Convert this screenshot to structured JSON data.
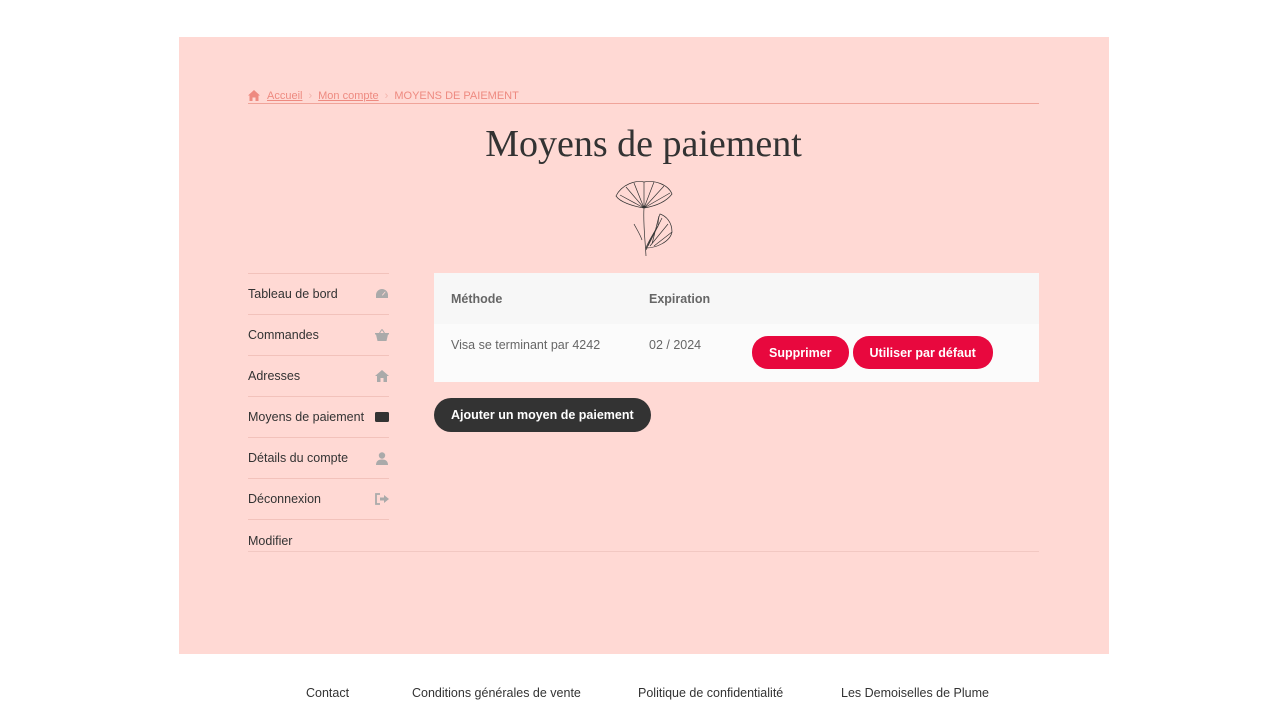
{
  "breadcrumb": {
    "home": "Accueil",
    "account": "Mon compte",
    "current": "MOYENS DE PAIEMENT"
  },
  "page_title": "Moyens de paiement",
  "sidebar": {
    "items": [
      {
        "label": "Tableau de bord",
        "icon": "dashboard-icon"
      },
      {
        "label": "Commandes",
        "icon": "basket-icon"
      },
      {
        "label": "Adresses",
        "icon": "home-icon"
      },
      {
        "label": "Moyens de paiement",
        "icon": "credit-card-icon"
      },
      {
        "label": "Détails du compte",
        "icon": "user-icon"
      },
      {
        "label": "Déconnexion",
        "icon": "sign-out-icon"
      }
    ],
    "edit_label": "Modifier"
  },
  "table": {
    "headers": {
      "method": "Méthode",
      "expiration": "Expiration"
    },
    "rows": [
      {
        "method": "Visa se terminant par 4242",
        "expiration": "02 / 2024",
        "delete_label": "Supprimer",
        "default_label": "Utiliser par défaut"
      }
    ]
  },
  "add_payment_label": "Ajouter un moyen de paiement",
  "footer": {
    "links": [
      "Contact",
      "Conditions générales de vente",
      "Politique de confidentialité",
      "Les Demoiselles de Plume"
    ]
  },
  "colors": {
    "panel_bg": "#ffd9d4",
    "accent_red": "#e8083e",
    "dark_button": "#333333",
    "breadcrumb": "#ee8a80"
  }
}
